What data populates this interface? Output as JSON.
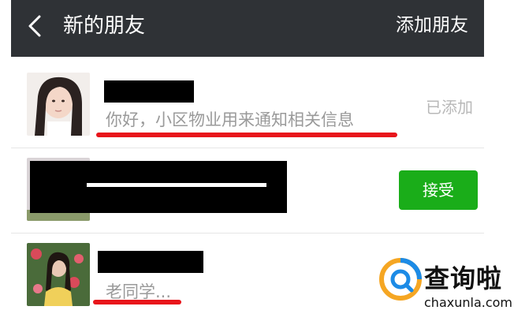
{
  "header": {
    "back_icon": "chevron-left-icon",
    "title": "新的朋友",
    "action_label": "添加朋友"
  },
  "requests": [
    {
      "name_visible": false,
      "message": "你好，小区物业用来通知相关信息",
      "status": "已添加"
    },
    {
      "name_visible": false,
      "message": "",
      "action": "接受"
    },
    {
      "name_visible": false,
      "message": "老同学...",
      "status": ""
    }
  ],
  "watermark": {
    "brand": "查询啦",
    "domain": "chaxunla.com"
  },
  "colors": {
    "header_bg": "#2f3236",
    "accept_green": "#1aad19",
    "annotation_red": "#e8151b",
    "muted_text": "#9a9a9a"
  }
}
